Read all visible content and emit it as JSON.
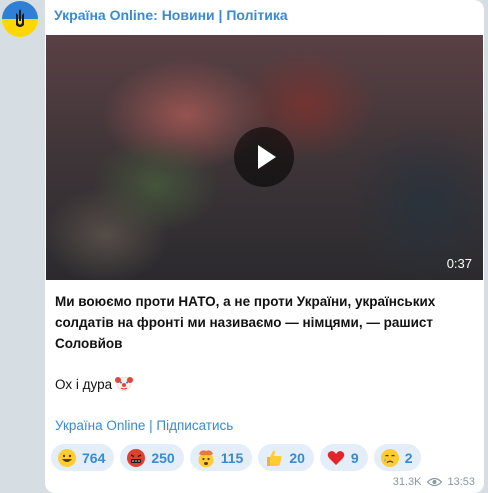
{
  "channel": {
    "name": "Україна Online: Новини | Політика"
  },
  "video": {
    "duration": "0:37"
  },
  "post": {
    "text_bold": "Ми воюємо проти НАТО, а не проти України, українських солдатів на фронті ми називаємо — німцями, — рашист Соловйов",
    "text_plain": "Ох і дура"
  },
  "footer": {
    "link": "Україна Online | Підписатись"
  },
  "reactions": [
    {
      "icon": "grinning-face",
      "count": "764"
    },
    {
      "icon": "face-with-symbols-on-mouth",
      "count": "250"
    },
    {
      "icon": "exploding-head",
      "count": "115"
    },
    {
      "icon": "thumbs-up",
      "count": "20"
    },
    {
      "icon": "red-heart",
      "count": "9"
    },
    {
      "icon": "crying-face",
      "count": "2"
    }
  ],
  "meta": {
    "views": "31.3K",
    "time": "13:53"
  },
  "colors": {
    "accent": "#3a8ad1",
    "reaction_bg": "#e3eef8",
    "background": "#d6dde3"
  }
}
